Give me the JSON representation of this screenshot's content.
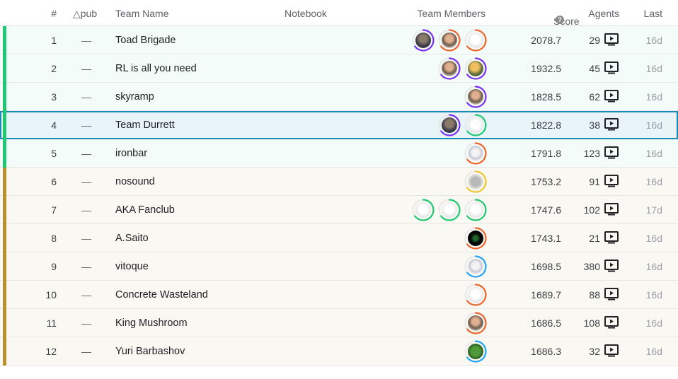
{
  "header": {
    "rank": "#",
    "delta": "△pub",
    "team_name": "Team Name",
    "notebook": "Notebook",
    "team_members": "Team Members",
    "score": "Score",
    "agents": "Agents",
    "last": "Last"
  },
  "colors": {
    "silver_bar": "#20c872",
    "gold_bar": "#b8912e",
    "selected_outline": "#1b8ab7",
    "tier_purple": "#7b2ff7",
    "tier_orange": "#f0642d",
    "tier_green": "#20c872",
    "tier_blue": "#20a4f3",
    "tier_gold": "#f0c330"
  },
  "rows": [
    {
      "rank": "1",
      "delta": "—",
      "team": "Toad Brigade",
      "score": "2078.7",
      "agents": "29",
      "last": "16d",
      "medal": "silver",
      "selected": false,
      "members": [
        {
          "ring": "purple",
          "avatar": "photo-dark"
        },
        {
          "ring": "orange",
          "avatar": "photo-person"
        },
        {
          "ring": "orange",
          "avatar": "default-goose"
        }
      ]
    },
    {
      "rank": "2",
      "delta": "—",
      "team": "RL is all you need",
      "score": "1932.5",
      "agents": "45",
      "last": "16d",
      "medal": "silver",
      "selected": false,
      "members": [
        {
          "ring": "purple",
          "avatar": "photo-person"
        },
        {
          "ring": "purple",
          "avatar": "photo-bright"
        }
      ]
    },
    {
      "rank": "3",
      "delta": "—",
      "team": "skyramp",
      "score": "1828.5",
      "agents": "62",
      "last": "16d",
      "medal": "silver",
      "selected": false,
      "members": [
        {
          "ring": "purple",
          "avatar": "photo-person"
        }
      ]
    },
    {
      "rank": "4",
      "delta": "—",
      "team": "Team Durrett",
      "score": "1822.8",
      "agents": "38",
      "last": "16d",
      "medal": "silver",
      "selected": true,
      "members": [
        {
          "ring": "purple",
          "avatar": "photo-dark"
        },
        {
          "ring": "green",
          "avatar": "default-goose"
        }
      ]
    },
    {
      "rank": "5",
      "delta": "—",
      "team": "ironbar",
      "score": "1791.8",
      "agents": "123",
      "last": "16d",
      "medal": "silver",
      "selected": false,
      "members": [
        {
          "ring": "orange",
          "avatar": "cartoon"
        }
      ]
    },
    {
      "rank": "6",
      "delta": "—",
      "team": "nosound",
      "score": "1753.2",
      "agents": "91",
      "last": "16d",
      "medal": "gold",
      "selected": false,
      "members": [
        {
          "ring": "gold",
          "avatar": "totoro"
        }
      ]
    },
    {
      "rank": "7",
      "delta": "—",
      "team": "AKA Fanclub",
      "score": "1747.6",
      "agents": "102",
      "last": "17d",
      "medal": "gold",
      "selected": false,
      "members": [
        {
          "ring": "green",
          "avatar": "default-goose"
        },
        {
          "ring": "green",
          "avatar": "default-goose"
        },
        {
          "ring": "green",
          "avatar": "default-goose"
        }
      ]
    },
    {
      "rank": "8",
      "delta": "—",
      "team": "A.Saito",
      "score": "1743.1",
      "agents": "21",
      "last": "16d",
      "medal": "gold",
      "selected": false,
      "members": [
        {
          "ring": "orange",
          "avatar": "dark-green"
        }
      ]
    },
    {
      "rank": "9",
      "delta": "—",
      "team": "vitoque",
      "score": "1698.5",
      "agents": "380",
      "last": "16d",
      "medal": "gold",
      "selected": false,
      "members": [
        {
          "ring": "blue",
          "avatar": "cartoon"
        }
      ]
    },
    {
      "rank": "10",
      "delta": "—",
      "team": "Concrete Wasteland",
      "score": "1689.7",
      "agents": "88",
      "last": "16d",
      "medal": "gold",
      "selected": false,
      "members": [
        {
          "ring": "orange",
          "avatar": "default-goose"
        }
      ]
    },
    {
      "rank": "11",
      "delta": "—",
      "team": "King Mushroom",
      "score": "1686.5",
      "agents": "108",
      "last": "16d",
      "medal": "gold",
      "selected": false,
      "members": [
        {
          "ring": "orange",
          "avatar": "photo-person"
        }
      ]
    },
    {
      "rank": "12",
      "delta": "—",
      "team": "Yuri Barbashov",
      "score": "1686.3",
      "agents": "32",
      "last": "16d",
      "medal": "gold",
      "selected": false,
      "members": [
        {
          "ring": "blue",
          "avatar": "pepe"
        }
      ]
    }
  ]
}
